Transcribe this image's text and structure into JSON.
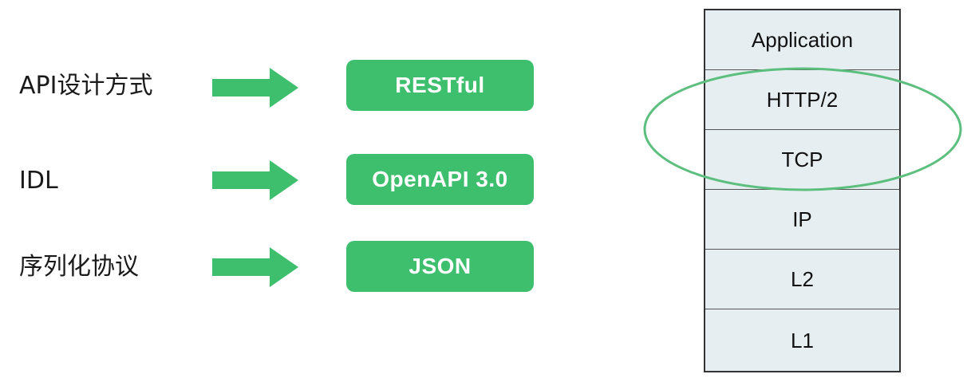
{
  "colors": {
    "accent_green": "#3dbf6e",
    "ellipse_green": "#5cbf7e",
    "stack_fill": "#e6eef2",
    "stack_border": "#333333"
  },
  "rows": [
    {
      "label": "API设计方式",
      "value": "RESTful"
    },
    {
      "label": "IDL",
      "value": "OpenAPI 3.0"
    },
    {
      "label": "序列化协议",
      "value": "JSON"
    }
  ],
  "stack": {
    "layers": [
      "Application",
      "HTTP/2",
      "TCP",
      "IP",
      "L2",
      "L1"
    ],
    "highlighted": [
      "HTTP/2",
      "TCP"
    ]
  }
}
